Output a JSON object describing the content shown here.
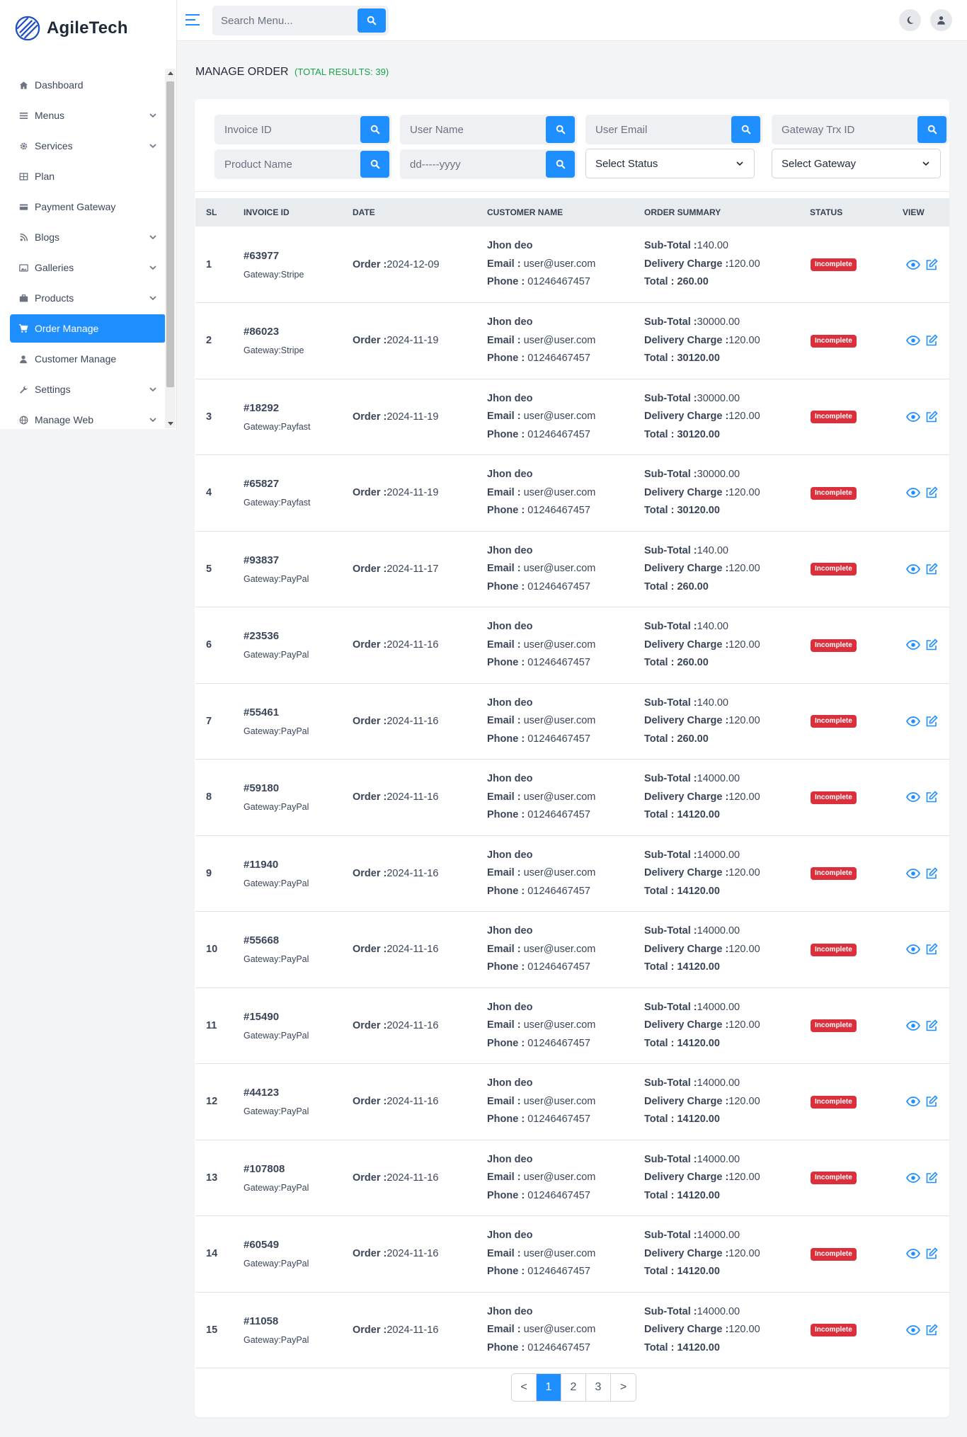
{
  "app": {
    "name": "AgileTech"
  },
  "sidebar": {
    "items": [
      {
        "label": "Dashboard",
        "icon": "home-icon",
        "has_submenu": false
      },
      {
        "label": "Menus",
        "icon": "list-icon",
        "has_submenu": true
      },
      {
        "label": "Services",
        "icon": "gear-icon",
        "has_submenu": true
      },
      {
        "label": "Plan",
        "icon": "table-icon",
        "has_submenu": false
      },
      {
        "label": "Payment Gateway",
        "icon": "credit-card-icon",
        "has_submenu": false
      },
      {
        "label": "Blogs",
        "icon": "blog-icon",
        "has_submenu": true
      },
      {
        "label": "Galleries",
        "icon": "image-icon",
        "has_submenu": true
      },
      {
        "label": "Products",
        "icon": "briefcase-icon",
        "has_submenu": true
      },
      {
        "label": "Order Manage",
        "icon": "cart-icon",
        "has_submenu": false,
        "active": true
      },
      {
        "label": "Customer Manage",
        "icon": "user-icon",
        "has_submenu": false
      },
      {
        "label": "Settings",
        "icon": "wrench-icon",
        "has_submenu": true
      },
      {
        "label": "Manage Web",
        "icon": "globe-icon",
        "has_submenu": true
      }
    ]
  },
  "header": {
    "search_placeholder": "Search Menu..."
  },
  "page": {
    "title": "MANAGE ORDER",
    "count_label": "(TOTAL RESULTS: 39)"
  },
  "filters": {
    "invoice_placeholder": "Invoice ID",
    "username_placeholder": "User Name",
    "email_placeholder": "User Email",
    "gateway_trx_placeholder": "Gateway Trx ID",
    "product_placeholder": "Product Name",
    "date_placeholder": "dd-----yyyy",
    "status_select": "Select Status",
    "gateway_select": "Select Gateway"
  },
  "table": {
    "columns": {
      "sl": "SL",
      "invoice": "INVOICE ID",
      "date": "DATE",
      "customer": "CUSTOMER NAME",
      "summary": "ORDER SUMMARY",
      "status": "STATUS",
      "view": "VIEW"
    },
    "labels": {
      "order": "Order :",
      "email": "Email :",
      "phone": "Phone :",
      "subtotal": "Sub-Total :",
      "delivery": "Delivery Charge :",
      "total": "Total :"
    },
    "rows": [
      {
        "sl": "1",
        "invoice": "#63977",
        "gateway": "Gateway:Stripe",
        "date": "2024-12-09",
        "name": "Jhon deo",
        "email": "user@user.com",
        "phone": "01246467457",
        "subtotal": "140.00",
        "delivery": "120.00",
        "total": "260.00",
        "status": "Incomplete"
      },
      {
        "sl": "2",
        "invoice": "#86023",
        "gateway": "Gateway:Stripe",
        "date": "2024-11-19",
        "name": "Jhon deo",
        "email": "user@user.com",
        "phone": "01246467457",
        "subtotal": "30000.00",
        "delivery": "120.00",
        "total": "30120.00",
        "status": "Incomplete"
      },
      {
        "sl": "3",
        "invoice": "#18292",
        "gateway": "Gateway:Payfast",
        "date": "2024-11-19",
        "name": "Jhon deo",
        "email": "user@user.com",
        "phone": "01246467457",
        "subtotal": "30000.00",
        "delivery": "120.00",
        "total": "30120.00",
        "status": "Incomplete"
      },
      {
        "sl": "4",
        "invoice": "#65827",
        "gateway": "Gateway:Payfast",
        "date": "2024-11-19",
        "name": "Jhon deo",
        "email": "user@user.com",
        "phone": "01246467457",
        "subtotal": "30000.00",
        "delivery": "120.00",
        "total": "30120.00",
        "status": "Incomplete"
      },
      {
        "sl": "5",
        "invoice": "#93837",
        "gateway": "Gateway:PayPal",
        "date": "2024-11-17",
        "name": "Jhon deo",
        "email": "user@user.com",
        "phone": "01246467457",
        "subtotal": "140.00",
        "delivery": "120.00",
        "total": "260.00",
        "status": "Incomplete"
      },
      {
        "sl": "6",
        "invoice": "#23536",
        "gateway": "Gateway:PayPal",
        "date": "2024-11-16",
        "name": "Jhon deo",
        "email": "user@user.com",
        "phone": "01246467457",
        "subtotal": "140.00",
        "delivery": "120.00",
        "total": "260.00",
        "status": "Incomplete"
      },
      {
        "sl": "7",
        "invoice": "#55461",
        "gateway": "Gateway:PayPal",
        "date": "2024-11-16",
        "name": "Jhon deo",
        "email": "user@user.com",
        "phone": "01246467457",
        "subtotal": "140.00",
        "delivery": "120.00",
        "total": "260.00",
        "status": "Incomplete"
      },
      {
        "sl": "8",
        "invoice": "#59180",
        "gateway": "Gateway:PayPal",
        "date": "2024-11-16",
        "name": "Jhon deo",
        "email": "user@user.com",
        "phone": "01246467457",
        "subtotal": "14000.00",
        "delivery": "120.00",
        "total": "14120.00",
        "status": "Incomplete"
      },
      {
        "sl": "9",
        "invoice": "#11940",
        "gateway": "Gateway:PayPal",
        "date": "2024-11-16",
        "name": "Jhon deo",
        "email": "user@user.com",
        "phone": "01246467457",
        "subtotal": "14000.00",
        "delivery": "120.00",
        "total": "14120.00",
        "status": "Incomplete"
      },
      {
        "sl": "10",
        "invoice": "#55668",
        "gateway": "Gateway:PayPal",
        "date": "2024-11-16",
        "name": "Jhon deo",
        "email": "user@user.com",
        "phone": "01246467457",
        "subtotal": "14000.00",
        "delivery": "120.00",
        "total": "14120.00",
        "status": "Incomplete"
      },
      {
        "sl": "11",
        "invoice": "#15490",
        "gateway": "Gateway:PayPal",
        "date": "2024-11-16",
        "name": "Jhon deo",
        "email": "user@user.com",
        "phone": "01246467457",
        "subtotal": "14000.00",
        "delivery": "120.00",
        "total": "14120.00",
        "status": "Incomplete"
      },
      {
        "sl": "12",
        "invoice": "#44123",
        "gateway": "Gateway:PayPal",
        "date": "2024-11-16",
        "name": "Jhon deo",
        "email": "user@user.com",
        "phone": "01246467457",
        "subtotal": "14000.00",
        "delivery": "120.00",
        "total": "14120.00",
        "status": "Incomplete"
      },
      {
        "sl": "13",
        "invoice": "#107808",
        "gateway": "Gateway:PayPal",
        "date": "2024-11-16",
        "name": "Jhon deo",
        "email": "user@user.com",
        "phone": "01246467457",
        "subtotal": "14000.00",
        "delivery": "120.00",
        "total": "14120.00",
        "status": "Incomplete"
      },
      {
        "sl": "14",
        "invoice": "#60549",
        "gateway": "Gateway:PayPal",
        "date": "2024-11-16",
        "name": "Jhon deo",
        "email": "user@user.com",
        "phone": "01246467457",
        "subtotal": "14000.00",
        "delivery": "120.00",
        "total": "14120.00",
        "status": "Incomplete"
      },
      {
        "sl": "15",
        "invoice": "#11058",
        "gateway": "Gateway:PayPal",
        "date": "2024-11-16",
        "name": "Jhon deo",
        "email": "user@user.com",
        "phone": "01246467457",
        "subtotal": "14000.00",
        "delivery": "120.00",
        "total": "14120.00",
        "status": "Incomplete"
      }
    ]
  },
  "pagination": {
    "prev": "<",
    "pages": [
      "1",
      "2",
      "3"
    ],
    "next": ">",
    "current": "1"
  },
  "colors": {
    "accent": "#1f8fff",
    "status_incomplete": "#dc2f3c",
    "count_text": "#16a34a"
  }
}
